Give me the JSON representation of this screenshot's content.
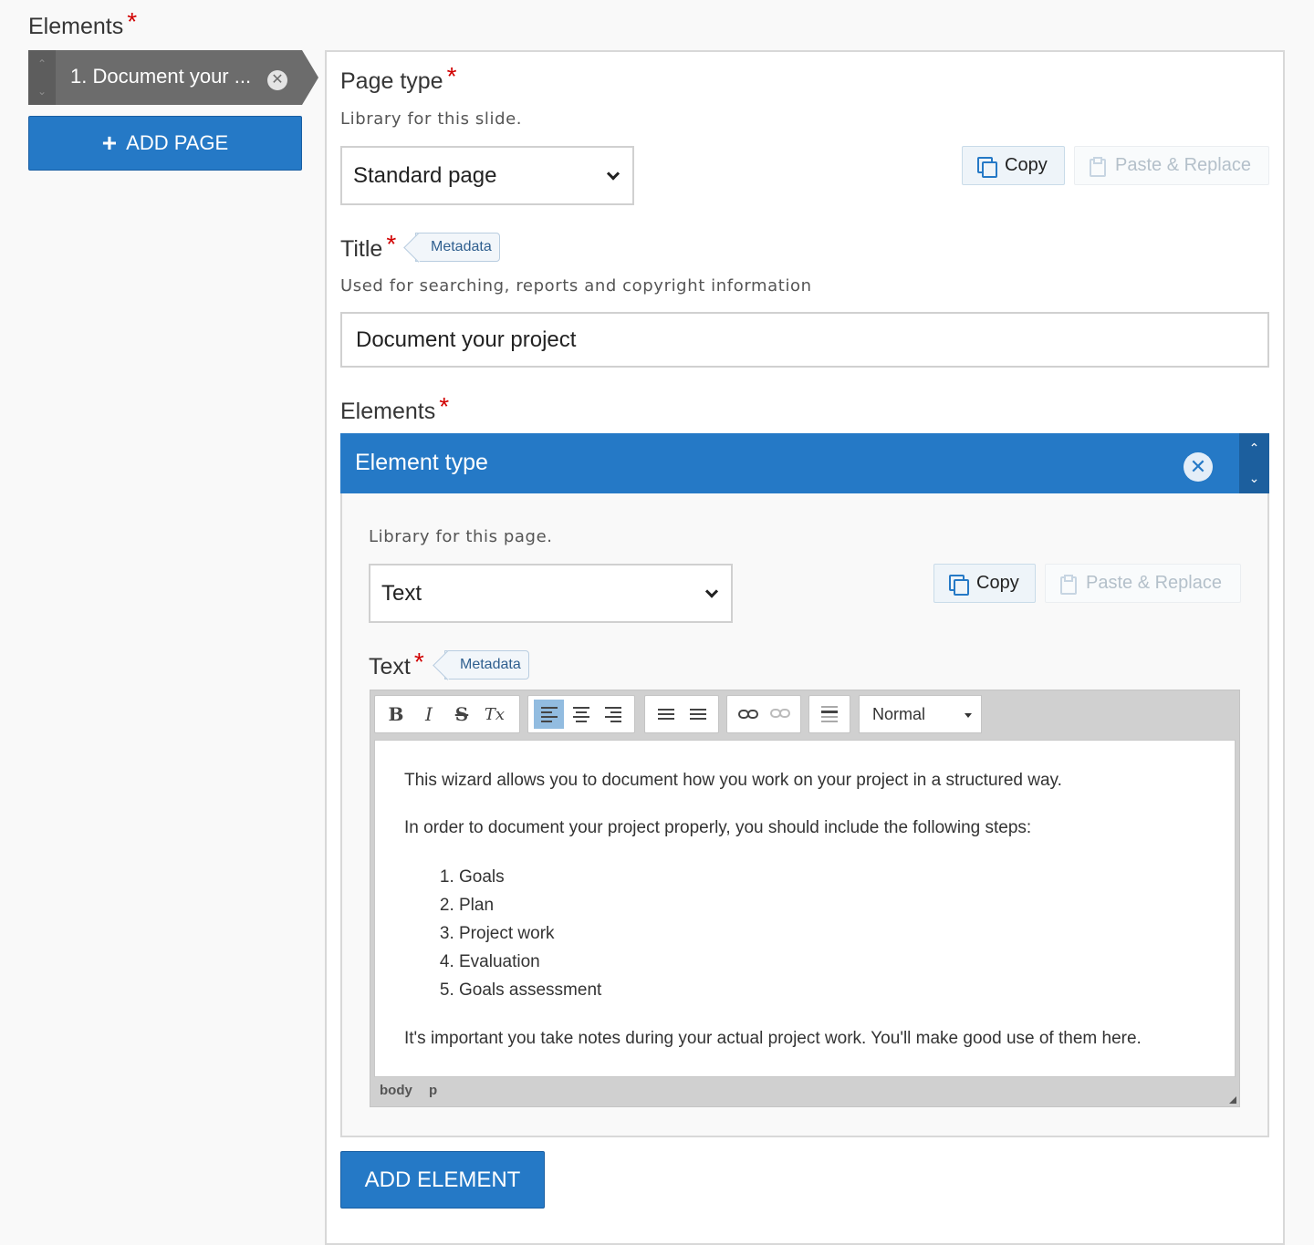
{
  "outer": {
    "label": "Elements",
    "required_mark": "*",
    "pages": [
      {
        "label": "1. Document your ...",
        "order_up": "⌃",
        "order_down": "⌄",
        "remove": "✕"
      }
    ],
    "add_page_label": "ADD PAGE",
    "add_page_icon": "+"
  },
  "page": {
    "page_type_label": "Page type",
    "page_type_desc": "Library for this slide.",
    "page_type_value": "Standard page",
    "copy_label": "Copy",
    "paste_label": "Paste & Replace",
    "title_label": "Title",
    "metadata_label": "Metadata",
    "title_desc": "Used for searching, reports and copyright information",
    "title_value": "Document your project",
    "elements_label": "Elements",
    "add_element_label": "ADD ELEMENT"
  },
  "element": {
    "header_title": "Element type",
    "remove": "✕",
    "order_up": "⌃",
    "order_down": "⌄",
    "library_desc": "Library for this page.",
    "library_value": "Text",
    "copy_label": "Copy",
    "paste_label": "Paste & Replace",
    "text_label": "Text",
    "metadata_label": "Metadata"
  },
  "editor": {
    "toolbar": {
      "bold": "B",
      "italic": "I",
      "strike": "S",
      "remove_format": "Tx",
      "format_value": "Normal"
    },
    "paragraph1": "This wizard allows you to document how you work on your project in a structured way.",
    "paragraph2": "In order to document your project properly, you should include the following steps:",
    "steps": [
      "Goals",
      "Plan",
      "Project work",
      "Evaluation",
      "Goals assessment"
    ],
    "paragraph3": "It's important you take notes during your actual project work. You'll make good use of them here.",
    "path": [
      "body",
      "p"
    ]
  },
  "colors": {
    "primary": "#2579c6",
    "required": "#d10000",
    "tab_bg": "#6c6c6c"
  }
}
